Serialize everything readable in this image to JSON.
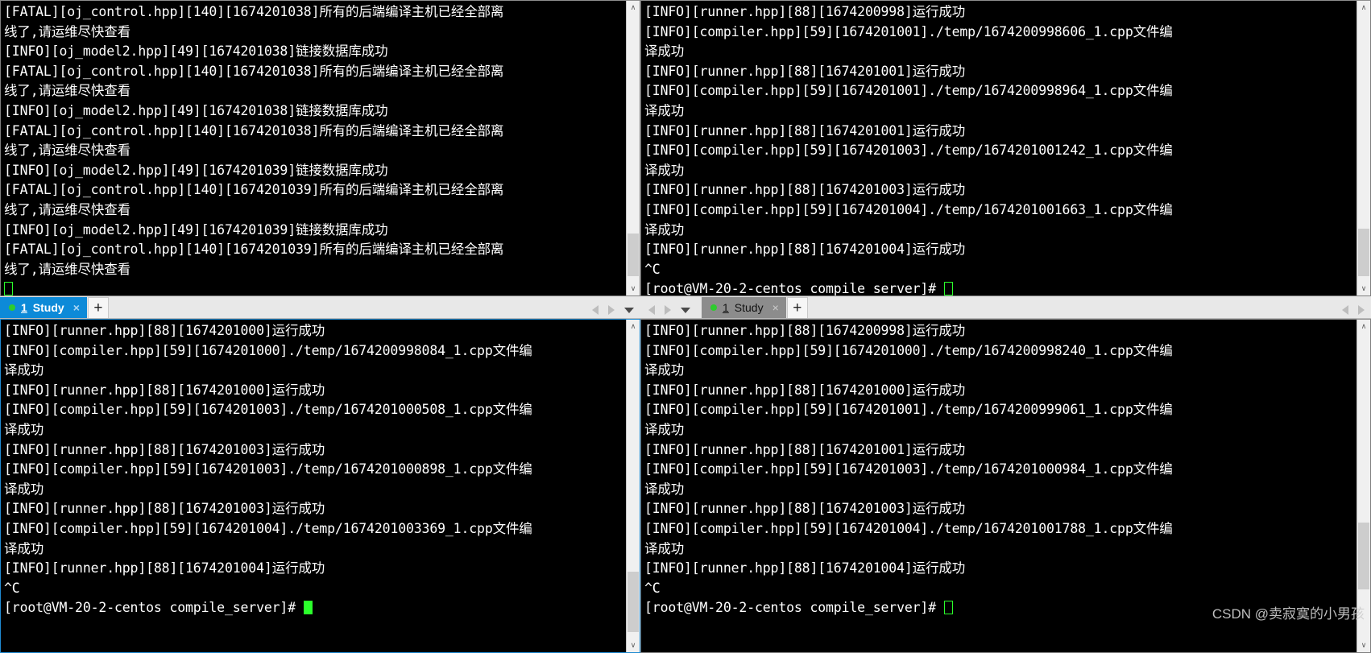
{
  "app": {
    "name": "terminal-multiplexer",
    "accent_active_tab": "#0d8ad8",
    "accent_inactive_tab": "#8c8c8c",
    "terminal_bg": "#000000",
    "terminal_fg": "#ffffff",
    "cursor_color": "#2bff2b"
  },
  "tabs": {
    "label_num": "1",
    "label_name": "Study",
    "close_glyph": "×",
    "new_tab_glyph": "+",
    "nav_prev": "◀",
    "nav_next": "▶",
    "nav_menu": "▼"
  },
  "scrollbar": {
    "up_glyph": "∧",
    "down_glyph": "∨"
  },
  "watermark": "CSDN @卖寂寞的小男孩",
  "panels": {
    "top_left": {
      "name": "oj-control-log",
      "active": false,
      "has_tabstrip": false,
      "scrollbar": {
        "visible": true,
        "thumb_top_pct": 82,
        "thumb_height_pct": 16
      },
      "lines": [
        "[FATAL][oj_control.hpp][140][1674201038]所有的后端编译主机已经全部离",
        "线了,请运维尽快查看",
        "[INFO][oj_model2.hpp][49][1674201038]链接数据库成功",
        "[FATAL][oj_control.hpp][140][1674201038]所有的后端编译主机已经全部离",
        "线了,请运维尽快查看",
        "[INFO][oj_model2.hpp][49][1674201038]链接数据库成功",
        "[FATAL][oj_control.hpp][140][1674201038]所有的后端编译主机已经全部离",
        "线了,请运维尽快查看",
        "[INFO][oj_model2.hpp][49][1674201039]链接数据库成功",
        "[FATAL][oj_control.hpp][140][1674201039]所有的后端编译主机已经全部离",
        "线了,请运维尽快查看",
        "[INFO][oj_model2.hpp][49][1674201039]链接数据库成功",
        "[FATAL][oj_control.hpp][140][1674201039]所有的后端编译主机已经全部离",
        "线了,请运维尽快查看"
      ],
      "cursor_style": "hollow"
    },
    "top_right": {
      "name": "compile-server-log-1",
      "active": false,
      "has_tabstrip": false,
      "scrollbar": {
        "visible": true,
        "thumb_top_pct": 80,
        "thumb_height_pct": 18
      },
      "lines": [
        "[INFO][runner.hpp][88][1674200998]运行成功",
        "[INFO][compiler.hpp][59][1674201001]./temp/1674200998606_1.cpp文件编",
        "译成功",
        "[INFO][runner.hpp][88][1674201001]运行成功",
        "[INFO][compiler.hpp][59][1674201001]./temp/1674200998964_1.cpp文件编",
        "译成功",
        "[INFO][runner.hpp][88][1674201001]运行成功",
        "[INFO][compiler.hpp][59][1674201003]./temp/1674201001242_1.cpp文件编",
        "译成功",
        "[INFO][runner.hpp][88][1674201003]运行成功",
        "[INFO][compiler.hpp][59][1674201004]./temp/1674201001663_1.cpp文件编",
        "译成功",
        "[INFO][runner.hpp][88][1674201004]运行成功",
        "^C"
      ],
      "prompt": "[root@VM-20-2-centos compile_server]# ",
      "cursor_style": "hollow"
    },
    "bottom_left": {
      "name": "compile-server-log-2",
      "active": true,
      "has_tabstrip": true,
      "tab_state": "active",
      "scrollbar": {
        "visible": true,
        "thumb_top_pct": 78,
        "thumb_height_pct": 20
      },
      "lines": [
        "[INFO][runner.hpp][88][1674201000]运行成功",
        "[INFO][compiler.hpp][59][1674201000]./temp/1674200998084_1.cpp文件编",
        "译成功",
        "[INFO][runner.hpp][88][1674201000]运行成功",
        "[INFO][compiler.hpp][59][1674201003]./temp/1674201000508_1.cpp文件编",
        "译成功",
        "[INFO][runner.hpp][88][1674201003]运行成功",
        "[INFO][compiler.hpp][59][1674201003]./temp/1674201000898_1.cpp文件编",
        "译成功",
        "[INFO][runner.hpp][88][1674201003]运行成功",
        "[INFO][compiler.hpp][59][1674201004]./temp/1674201003369_1.cpp文件编",
        "译成功",
        "[INFO][runner.hpp][88][1674201004]运行成功",
        "^C"
      ],
      "prompt": "[root@VM-20-2-centos compile_server]# ",
      "cursor_style": "filled"
    },
    "bottom_right": {
      "name": "compile-server-log-3",
      "active": false,
      "has_tabstrip": true,
      "tab_state": "inactive",
      "scrollbar": {
        "visible": true,
        "thumb_top_pct": 62,
        "thumb_height_pct": 22
      },
      "lines": [
        "[INFO][runner.hpp][88][1674200998]运行成功",
        "[INFO][compiler.hpp][59][1674201000]./temp/1674200998240_1.cpp文件编",
        "译成功",
        "[INFO][runner.hpp][88][1674201000]运行成功",
        "[INFO][compiler.hpp][59][1674201001]./temp/1674200999061_1.cpp文件编",
        "译成功",
        "[INFO][runner.hpp][88][1674201001]运行成功",
        "[INFO][compiler.hpp][59][1674201003]./temp/1674201000984_1.cpp文件编",
        "译成功",
        "[INFO][runner.hpp][88][1674201003]运行成功",
        "[INFO][compiler.hpp][59][1674201004]./temp/1674201001788_1.cpp文件编",
        "译成功",
        "[INFO][runner.hpp][88][1674201004]运行成功",
        "^C"
      ],
      "prompt": "[root@VM-20-2-centos compile_server]# ",
      "cursor_style": "hollow"
    }
  }
}
